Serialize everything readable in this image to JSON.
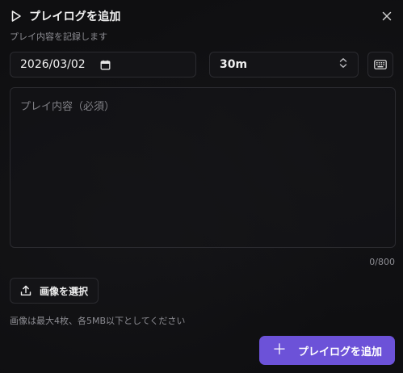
{
  "dialog": {
    "title": "プレイログを追加",
    "subtitle": "プレイ内容を記録します"
  },
  "form": {
    "date_value": "2026/03/02",
    "duration_value": "30m",
    "content_placeholder": "プレイ内容（必須）",
    "content_value": "",
    "char_counter": "0/800",
    "image_button_label": "画像を選択",
    "image_note": "画像は最大4枚、各5MB以下としてください",
    "submit_label": "プレイログを追加"
  },
  "icons": {
    "title": "play-icon",
    "close": "close-icon",
    "date": "calendar-icon",
    "duration": "chevron-updown-icon",
    "keyboard": "keyboard-icon",
    "upload": "upload-icon",
    "submit": "plus-icon"
  },
  "colors": {
    "accent": "#6c52d8",
    "background": "#0f0f11",
    "border": "#2b2b30",
    "muted_text": "#8d8d93"
  }
}
